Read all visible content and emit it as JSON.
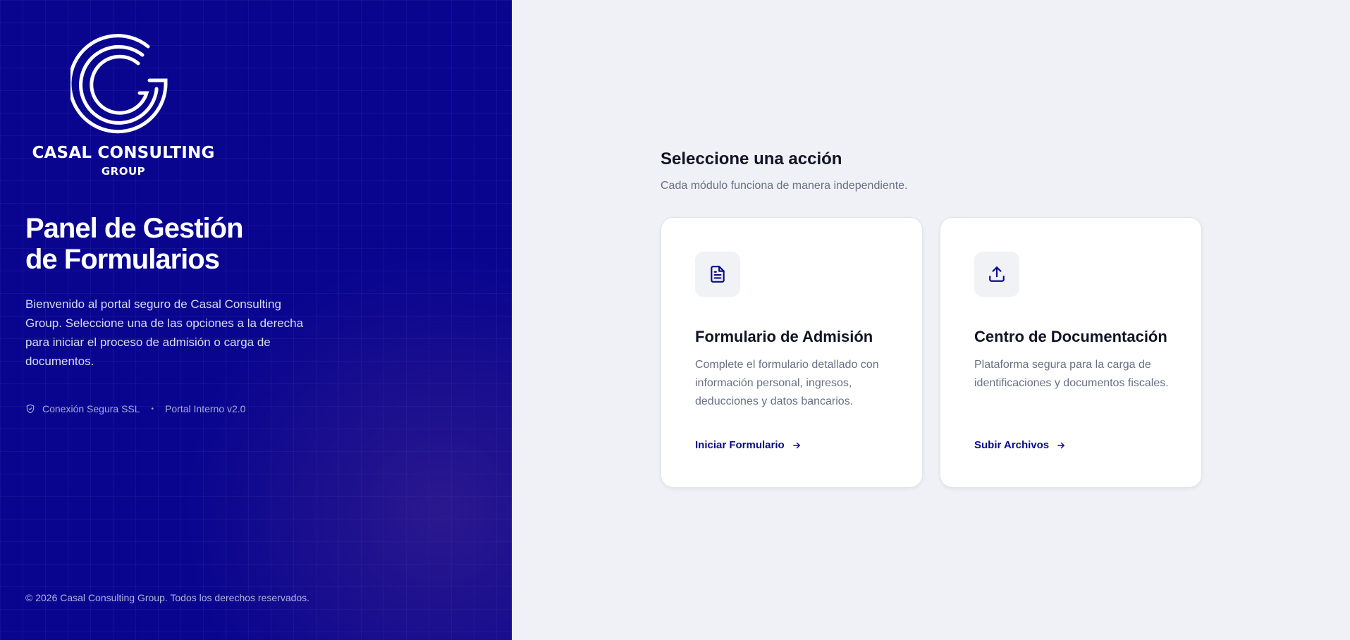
{
  "brand": {
    "name": "CASAL CONSULTING",
    "sub": "GROUP"
  },
  "hero": {
    "title_line1": "Panel de Gestión",
    "title_line2": "de Formularios",
    "description": "Bienvenido al portal seguro de Casal Consulting Group. Seleccione una de las opciones a la derecha para iniciar el proceso de admisión o carga de documentos."
  },
  "meta": {
    "secure": "Conexión Segura SSL",
    "separator": "•",
    "version": "Portal Interno v2.0"
  },
  "footer": {
    "copyright": "© 2026 Casal Consulting Group. Todos los derechos reservados."
  },
  "main": {
    "title": "Seleccione una acción",
    "subtitle": "Cada módulo funciona de manera independiente.",
    "cards": [
      {
        "icon": "document-icon",
        "title": "Formulario de Admisión",
        "description": "Complete el formulario detallado con información personal, ingresos, deducciones y datos bancarios.",
        "link": "Iniciar Formulario"
      },
      {
        "icon": "upload-icon",
        "title": "Centro de Documentación",
        "description": "Plataforma segura para la carga de identificaciones y documentos fiscales.",
        "link": "Subir Archivos"
      }
    ]
  },
  "colors": {
    "brand_blue": "#09058f",
    "link": "#0b0a8c",
    "background": "#eff1f6"
  }
}
